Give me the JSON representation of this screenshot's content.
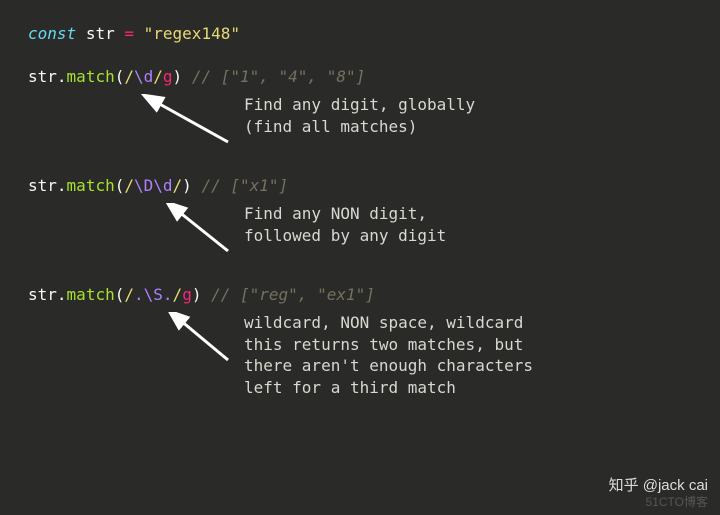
{
  "decl": {
    "keyword": "const",
    "name": "str",
    "eq": "=",
    "value": "\"regex148\""
  },
  "examples": [
    {
      "obj": "str",
      "dot": ".",
      "method": "match",
      "open": "(",
      "regex_open": "/",
      "regex_body_parts": [
        {
          "t": "\\d",
          "cls": "regex-esc"
        }
      ],
      "regex_close": "/",
      "flags": "g",
      "close": ")",
      "comment": "// [\"1\", \"4\", \"8\"]",
      "explain": "Find any digit, globally\n(find all matches)"
    },
    {
      "obj": "str",
      "dot": ".",
      "method": "match",
      "open": "(",
      "regex_open": "/",
      "regex_body_parts": [
        {
          "t": "\\D",
          "cls": "regex-esc"
        },
        {
          "t": "\\d",
          "cls": "regex-esc"
        }
      ],
      "regex_close": "/",
      "flags": "",
      "close": ")",
      "comment": "// [\"x1\"]",
      "explain": "Find any NON digit,\nfollowed by any digit"
    },
    {
      "obj": "str",
      "dot": ".",
      "method": "match",
      "open": "(",
      "regex_open": "/",
      "regex_body_parts": [
        {
          "t": ".",
          "cls": "regex-dot"
        },
        {
          "t": "\\S",
          "cls": "regex-esc"
        },
        {
          "t": ".",
          "cls": "regex-dot"
        }
      ],
      "regex_close": "/",
      "flags": "g",
      "close": ")",
      "comment": "// [\"reg\", \"ex1\"]",
      "explain": "wildcard, NON space, wildcard\nthis returns two matches, but\nthere aren't enough characters\nleft for a third match"
    }
  ],
  "watermark": {
    "line1": "知乎 @jack cai",
    "line2": "51CTO博客"
  }
}
